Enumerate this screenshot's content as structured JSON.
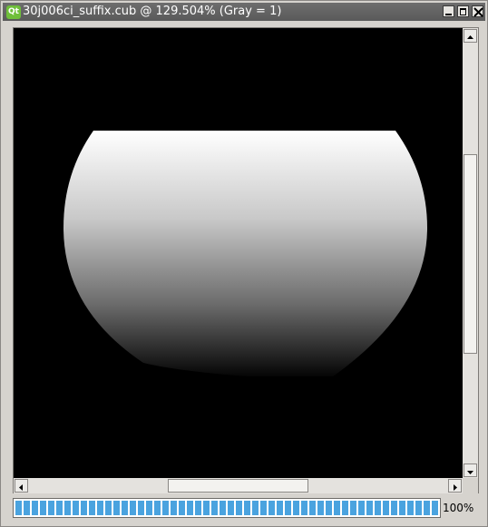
{
  "window": {
    "title": "30j006ci_suffix.cub @ 129.504% (Gray = 1)",
    "app_icon_label": "Qt"
  },
  "progress": {
    "percent": 100,
    "text": "100%"
  },
  "colors": {
    "titlebar": "#5f5f5f",
    "background": "#d6d3ce",
    "image_background": "#000000",
    "progress_fill": "#4aa3df"
  },
  "icons": {
    "minimize": "minimize-icon",
    "maximize": "maximize-icon",
    "close": "close-icon",
    "scroll_up": "arrow-up-icon",
    "scroll_down": "arrow-down-icon",
    "scroll_left": "arrow-left-icon",
    "scroll_right": "arrow-right-icon"
  }
}
